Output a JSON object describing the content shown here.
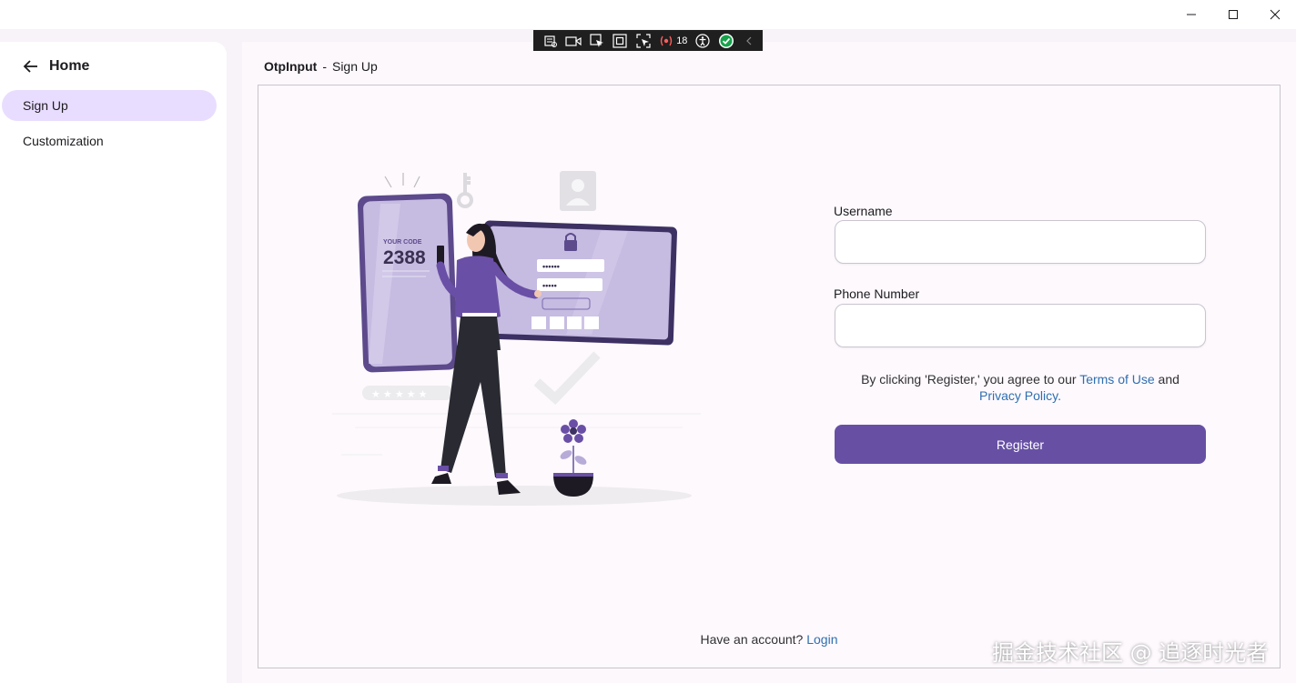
{
  "window": {
    "minimize_icon": "minimize-icon",
    "maximize_icon": "maximize-icon",
    "close_icon": "close-icon"
  },
  "devtools": {
    "count": "18",
    "icons": [
      "live-visual-tree-icon",
      "record-icon",
      "select-element-icon",
      "display-layout-adorners-icon",
      "track-focus-icon",
      "binding-failures-icon",
      "accessibility-icon",
      "check-icon",
      "chevron-left-icon"
    ]
  },
  "sidebar": {
    "home_label": "Home",
    "items": [
      {
        "label": "Sign Up",
        "selected": true
      },
      {
        "label": "Customization",
        "selected": false
      }
    ]
  },
  "breadcrumb": {
    "root": "OtpInput",
    "separator": "-",
    "page": "Sign Up"
  },
  "illustration": {
    "code_caption": "YOUR CODE",
    "code_value": "2388",
    "password_mask_1": "••••••",
    "password_mask_2": "•••••"
  },
  "form": {
    "username_label": "Username",
    "username_value": "",
    "phone_label": "Phone Number",
    "phone_value": "",
    "terms_prefix": "By clicking 'Register,' you agree to our ",
    "terms_link": "Terms of Use",
    "terms_and": " and",
    "privacy_link": "Privacy Policy",
    "terms_suffix": ".",
    "register_label": "Register",
    "account_prompt": "Have an account? ",
    "login_link": "Login"
  },
  "watermark": "掘金技术社区 @ 追逐时光者",
  "colors": {
    "accent": "#6750a4",
    "nav_selected": "#e9ddff",
    "link": "#2f6fb0",
    "background": "#f8f2f9"
  }
}
